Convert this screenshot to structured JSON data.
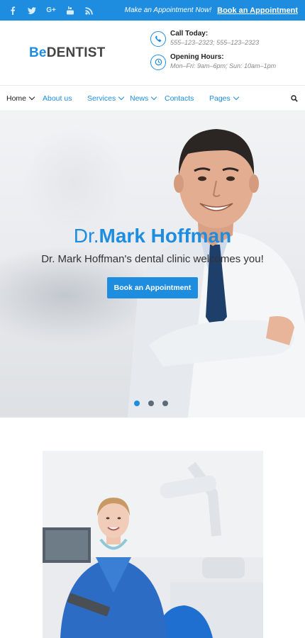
{
  "topbar": {
    "social_icons": [
      "facebook-icon",
      "twitter-icon",
      "google-plus-icon",
      "youtube-icon",
      "rss-icon"
    ],
    "make_text": "Make an Appointment Now!",
    "book_link": "Book an Appointment"
  },
  "header": {
    "logo_be": "Be",
    "logo_rest": "DENTIST",
    "call_title": "Call Today:",
    "call_value": "555–123–2323; 555–123–2323",
    "hours_title": "Opening Hours:",
    "hours_value": "Mon–Fri: 9am–6pm; Sun: 10am–1pm"
  },
  "nav": {
    "items": [
      {
        "label": "Home",
        "dropdown": true,
        "active": true
      },
      {
        "label": "About us",
        "dropdown": false
      },
      {
        "label": "Services",
        "dropdown": true
      },
      {
        "label": "News",
        "dropdown": true
      },
      {
        "label": "Contacts",
        "dropdown": false
      },
      {
        "label": "Pages",
        "dropdown": true
      }
    ]
  },
  "hero": {
    "title_prefix": "Dr.",
    "title_name": "Mark Hoffman",
    "subtitle": "Dr. Mark Hoffman's dental clinic welcomes you!",
    "button": "Book an Appointment",
    "slides": 3,
    "active_slide": 1
  },
  "colors": {
    "accent": "#1e8de0",
    "dark": "#222222"
  }
}
